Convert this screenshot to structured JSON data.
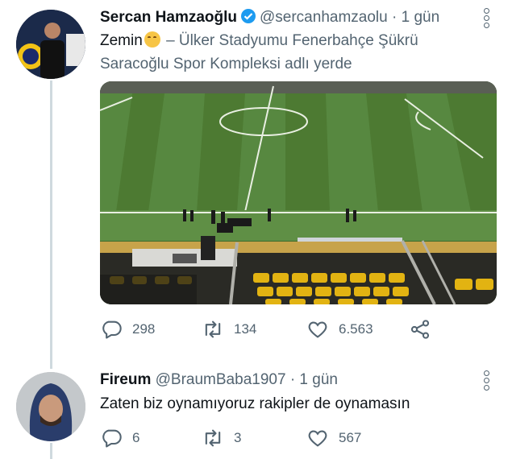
{
  "tweet": {
    "author_name": "Sercan Hamzaoğlu",
    "author_handle": "@sercanhamzaolu",
    "separator": "·",
    "time": "1 gün",
    "text_word": "Zemin",
    "location_text": "– Ülker Stadyumu Fenerbahçe Şükrü Saracoğlu Spor Kompleksi adlı yerde",
    "icons": {
      "verified": "verified-badge-icon",
      "emoji": "relieved-face-emoji",
      "more": "more-options-icon"
    },
    "stats": {
      "replies": "298",
      "retweets": "134",
      "likes": "6.563"
    }
  },
  "reply": {
    "author_name": "Fireum",
    "author_handle": "@BraumBaba1907",
    "separator": "·",
    "time": "1 gün",
    "text": "Zaten biz oynamıyoruz rakipler de oynamasın",
    "stats": {
      "replies": "6",
      "retweets": "3",
      "likes": "567"
    }
  },
  "colors": {
    "verified": "#1d9bf0",
    "secondary_text": "#536471",
    "thread_line": "#cfd9de"
  }
}
